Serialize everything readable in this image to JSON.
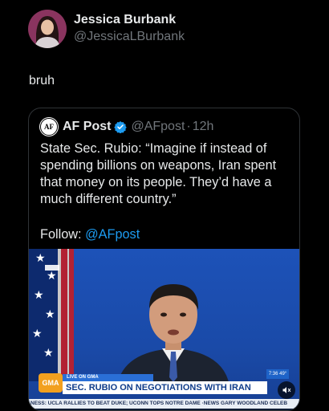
{
  "post": {
    "author_name": "Jessica Burbank",
    "author_handle": "@JessicaLBurbank",
    "text": "bruh"
  },
  "quote": {
    "avatar_letters": "AF",
    "name": "AF Post",
    "handle": "@AFpost",
    "separator": "·",
    "time": "12h",
    "body": "State Sec. Rubio: “Imagine if instead of spending billions on weapons, Iran spent that money on its people. They’d have a much different country.”",
    "follow_prefix": "Follow: ",
    "follow_mention": "@AFpost"
  },
  "video": {
    "live_label": "LIVE ON GMA",
    "network_logo": "GMA",
    "headline": "SEC. RUBIO ON NEGOTIATIONS WITH IRAN",
    "clock": "7:36  49°",
    "ticker": "NESS: UCLA RALLIES TO BEAT DUKE;  UCONN TOPS NOTRE DAME    ·NEWS    GARY WOODLAND CELEB"
  },
  "colors": {
    "accent_link": "#1d9bf0",
    "verified": "#1d9bf0",
    "background": "#000000"
  },
  "icons": {
    "verified": "verified-badge-icon",
    "mute": "mute-icon"
  }
}
